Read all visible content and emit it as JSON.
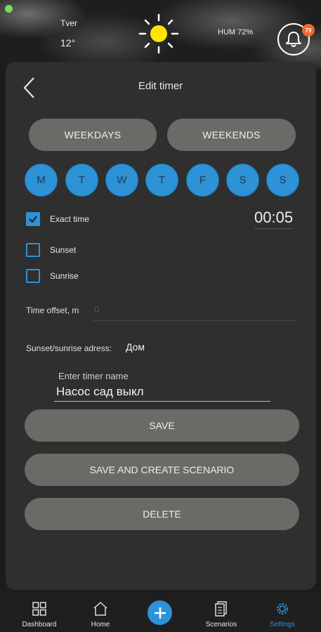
{
  "header": {
    "city": "Tver",
    "temperature": "12°",
    "humidity": "HUM 72%",
    "weather_icon": "sun-icon",
    "notifications_count": "79"
  },
  "screen": {
    "title": "Edit timer",
    "weekdays_label": "WEEKDAYS",
    "weekends_label": "WEEKENDS",
    "days": [
      "M",
      "T",
      "W",
      "T",
      "F",
      "S",
      "S"
    ],
    "options": [
      {
        "label": "Exact time",
        "checked": true
      },
      {
        "label": "Sunset",
        "checked": false
      },
      {
        "label": "Sunrise",
        "checked": false
      }
    ],
    "exact_time_value": "00:05",
    "offset_label": "Time offset, m",
    "offset_value": "0",
    "address_label": "Sunset/sunrise adress:",
    "address_value": "Дом",
    "name_label": "Enter timer name",
    "name_value": "Насос сад выкл",
    "save_label": "SAVE",
    "save_create_label": "SAVE AND CREATE SCENARIO",
    "delete_label": "DELETE"
  },
  "nav": {
    "items": [
      {
        "label": "Dashboard",
        "icon": "dashboard-icon"
      },
      {
        "label": "Home",
        "icon": "home-icon"
      },
      {
        "label": "Scenarios",
        "icon": "scenarios-icon"
      },
      {
        "label": "Settings",
        "icon": "settings-icon"
      }
    ],
    "active": "Settings"
  },
  "colors": {
    "accent": "#2d92d6",
    "button_bg": "#6a6a66",
    "card_bg": "#2f2f2f",
    "badge": "#ef6a2a"
  }
}
